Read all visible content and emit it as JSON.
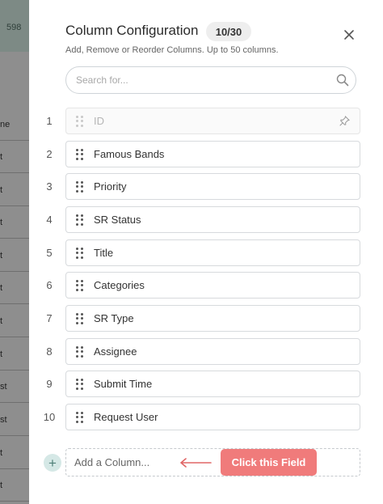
{
  "background": {
    "top_number": "598",
    "cells": [
      "ne",
      "t",
      "t",
      "t",
      "t",
      "t",
      "t",
      "t",
      "st",
      "st",
      "t",
      "t"
    ]
  },
  "dialog": {
    "title": "Column Configuration",
    "count_badge": "10/30",
    "subtitle": "Add, Remove or Reorder Columns. Up to 50 columns.",
    "close_icon": "close-icon"
  },
  "search": {
    "placeholder": "Search for...",
    "value": "",
    "icon": "search-icon"
  },
  "columns": [
    {
      "index": "1",
      "label": "ID",
      "locked": true,
      "icon": "pin-icon"
    },
    {
      "index": "2",
      "label": "Famous Bands"
    },
    {
      "index": "3",
      "label": "Priority"
    },
    {
      "index": "4",
      "label": "SR Status"
    },
    {
      "index": "5",
      "label": "Title"
    },
    {
      "index": "6",
      "label": "Categories"
    },
    {
      "index": "7",
      "label": "SR Type"
    },
    {
      "index": "8",
      "label": "Assignee"
    },
    {
      "index": "9",
      "label": "Submit Time"
    },
    {
      "index": "10",
      "label": "Request User"
    }
  ],
  "add_column": {
    "button_label": "+",
    "placeholder": "Add a Column...",
    "value": ""
  },
  "callout": {
    "label": "Click this Field",
    "color": "#f07b7b"
  },
  "colors": {
    "accent": "#d5e8e6",
    "callout": "#f07b7b",
    "overlay": "#8e8e8e"
  }
}
